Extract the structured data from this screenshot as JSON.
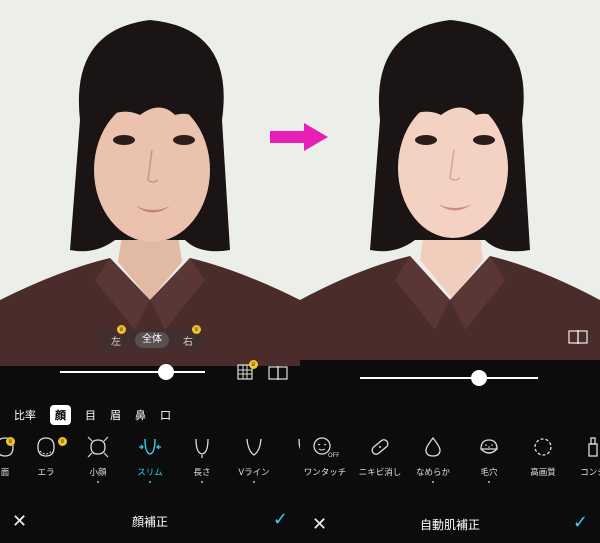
{
  "left": {
    "region": {
      "left_label": "左",
      "all_label": "全体",
      "right_label": "右"
    },
    "tabs": [
      "比率",
      "顔",
      "目",
      "眉",
      "鼻",
      "口"
    ],
    "active_tab": "顔",
    "tools": [
      "面",
      "エラ",
      "小顔",
      "スリム",
      "長さ",
      "Vライン"
    ],
    "active_tool": "スリム",
    "title": "顔補正"
  },
  "right": {
    "tools": [
      "ワンタッチ",
      "ニキビ消し",
      "なめらか",
      "毛穴",
      "高画質",
      "コンシ"
    ],
    "title": "自動肌補正"
  },
  "colors": {
    "accent": "#3ad1e8",
    "arrow": "#e91eb7",
    "premium": "#f3c431"
  }
}
